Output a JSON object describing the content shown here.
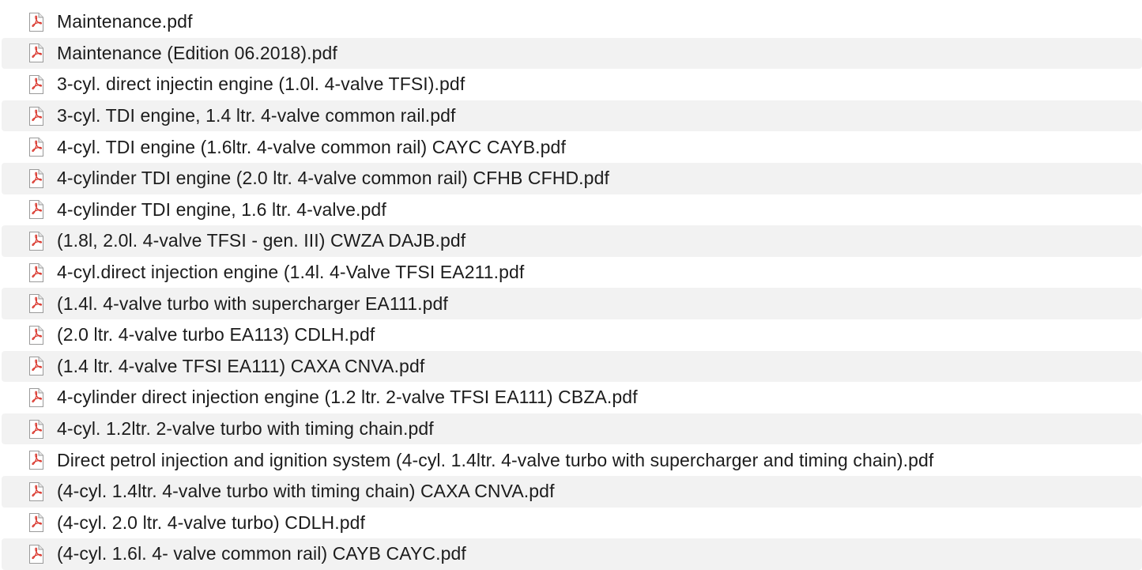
{
  "file_icon": "pdf-document-icon",
  "accent_color": "#d9352b",
  "row_alt_color": "#f2f2f2",
  "files": [
    "Maintenance.pdf",
    "Maintenance (Edition 06.2018).pdf",
    "3-cyl. direct injectin engine (1.0l. 4-valve TFSI).pdf",
    "3-cyl. TDI engine, 1.4 ltr. 4-valve common rail.pdf",
    "4-cyl. TDI engine (1.6ltr. 4-valve common rail) CAYC CAYB.pdf",
    "4-cylinder TDI engine (2.0 ltr. 4-valve common rail) CFHB CFHD.pdf",
    "4-cylinder TDI engine, 1.6 ltr. 4-valve.pdf",
    "(1.8l, 2.0l. 4-valve TFSI - gen. III) CWZA DAJB.pdf",
    "4-cyl.direct injection engine (1.4l. 4-Valve TFSI EA211.pdf",
    "(1.4l. 4-valve turbo with supercharger EA111.pdf",
    "(2.0 ltr. 4-valve turbo EA113) CDLH.pdf",
    "(1.4 ltr. 4-valve TFSI EA111) CAXA CNVA.pdf",
    "4-cylinder direct injection engine (1.2 ltr. 2-valve TFSI EA111) CBZA.pdf",
    "4-cyl. 1.2ltr. 2-valve turbo with timing chain.pdf",
    "Direct petrol injection and ignition system (4-cyl. 1.4ltr. 4-valve turbo with supercharger and timing chain).pdf",
    "(4-cyl. 1.4ltr. 4-valve turbo with timing chain) CAXA CNVA.pdf",
    "(4-cyl. 2.0 ltr. 4-valve turbo)  CDLH.pdf",
    "(4-cyl. 1.6l. 4- valve common rail) CAYB CAYC.pdf"
  ]
}
